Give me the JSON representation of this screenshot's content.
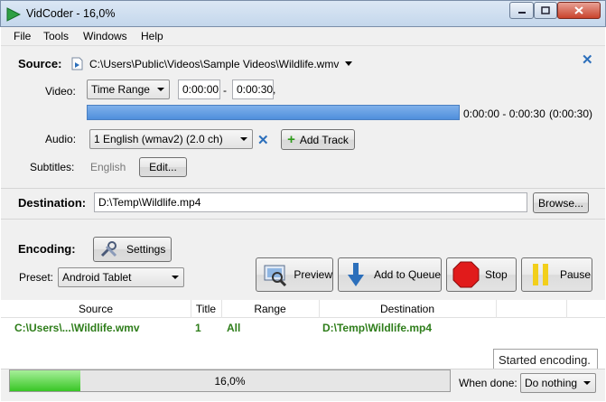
{
  "window": {
    "title": "VidCoder - 16,0%"
  },
  "menu": [
    "File",
    "Tools",
    "Windows",
    "Help"
  ],
  "source": {
    "label": "Source:",
    "path": "C:\\Users\\Public\\Videos\\Sample Videos\\Wildlife.wmv",
    "video_label": "Video:",
    "video_mode": "Time Range",
    "start": "0:00:00",
    "dash": "-",
    "end": "0:00:30,",
    "range_text": "0:00:00 - 0:00:30",
    "duration_text": "(0:00:30)",
    "audio_label": "Audio:",
    "audio_track": "1 English (wmav2) (2.0 ch)",
    "add_track": "Add Track",
    "subtitles_label": "Subtitles:",
    "subtitles_value": "English",
    "edit": "Edit..."
  },
  "destination": {
    "label": "Destination:",
    "path": "D:\\Temp\\Wildlife.mp4",
    "browse": "Browse..."
  },
  "encoding": {
    "label": "Encoding:",
    "settings": "Settings",
    "preset_label": "Preset:",
    "preset": "Android Tablet",
    "preview": "Preview",
    "add_to_queue": "Add to Queue",
    "stop": "Stop",
    "pause": "Pause"
  },
  "queue": {
    "columns": [
      "Source",
      "Title",
      "Range",
      "Destination"
    ],
    "rows": [
      {
        "source": "C:\\Users\\...\\Wildlife.wmv",
        "title": "1",
        "range": "All",
        "destination": "D:\\Temp\\Wildlife.mp4"
      }
    ]
  },
  "status": {
    "tooltip": "Started encoding.",
    "progress": 0.16,
    "progress_text": "16,0%",
    "when_done_label": "When done:",
    "when_done_value": "Do nothing"
  },
  "colors": {
    "accent_blue": "#4f8fdc",
    "queue_text": "#2e7d1a",
    "progress_green": "#38c625"
  }
}
